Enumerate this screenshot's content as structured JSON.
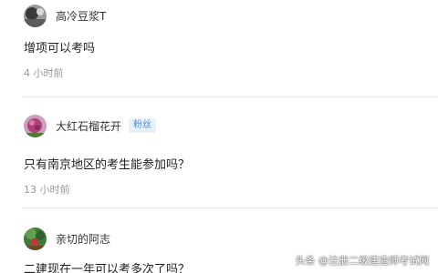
{
  "comments": [
    {
      "username": "高冷豆浆T",
      "text": "增项可以考吗",
      "time": "4 小时前",
      "avatar_icon": "user-avatar-bw"
    },
    {
      "username": "大红石榴花开",
      "badge": "粉丝",
      "text": "只有南京地区的考生能参加吗？",
      "time": "13 小时前",
      "avatar_icon": "user-avatar-flower"
    },
    {
      "username": "亲切的阿志",
      "text": "二建现在一年可以考多次了吗？",
      "avatar_icon": "user-avatar-garden"
    }
  ],
  "watermark": "头条 @注册二级建造师考试网",
  "colors": {
    "badge_text": "#4a90d9",
    "badge_bg": "#e8f1fb",
    "time_text": "#999999",
    "divider": "#e8e8e8"
  }
}
